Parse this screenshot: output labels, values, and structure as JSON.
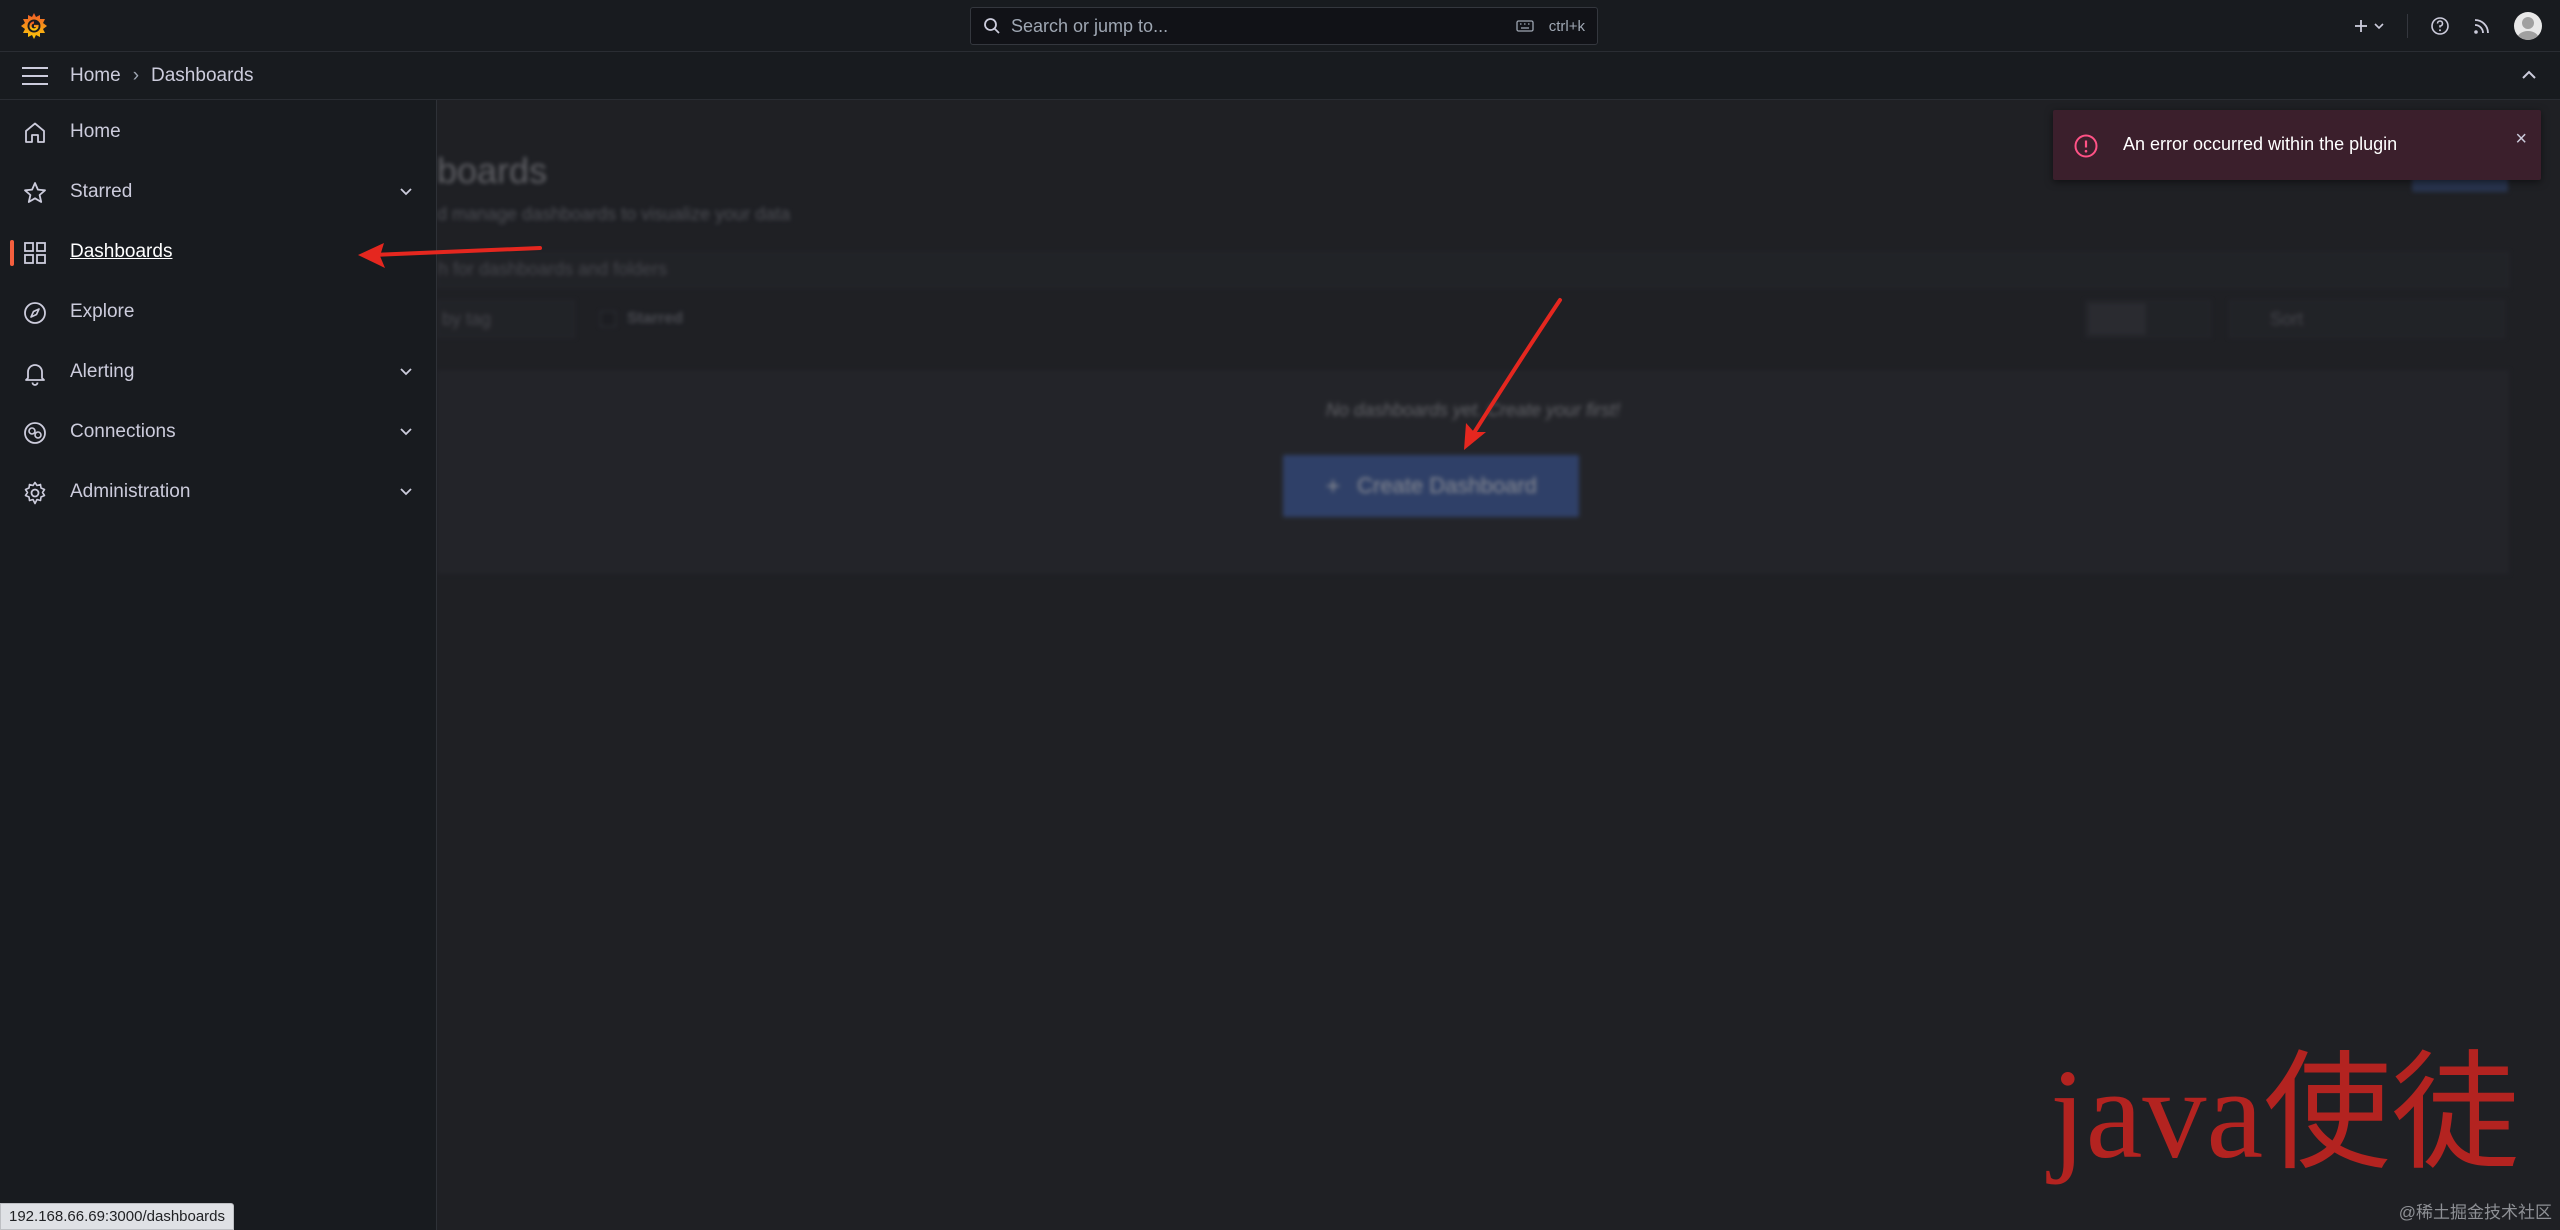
{
  "topbar": {
    "search_placeholder": "Search or jump to...",
    "search_shortcut": "ctrl+k"
  },
  "breadcrumb": {
    "home": "Home",
    "separator": "›",
    "current": "Dashboards"
  },
  "sidebar": {
    "items": [
      {
        "label": "Home",
        "icon": "home-icon",
        "expandable": false
      },
      {
        "label": "Starred",
        "icon": "star-icon",
        "expandable": true
      },
      {
        "label": "Dashboards",
        "icon": "apps-grid-icon",
        "expandable": false,
        "active": true
      },
      {
        "label": "Explore",
        "icon": "compass-icon",
        "expandable": false
      },
      {
        "label": "Alerting",
        "icon": "bell-icon",
        "expandable": true
      },
      {
        "label": "Connections",
        "icon": "link-icon",
        "expandable": true
      },
      {
        "label": "Administration",
        "icon": "gear-icon",
        "expandable": true
      }
    ]
  },
  "main": {
    "title": "boards",
    "subtitle": "d manage dashboards to visualize your data",
    "search_placeholder": "h for dashboards and folders",
    "tag_filter": "by tag",
    "starred_label": "Starred",
    "sort_label": "Sort",
    "empty_text": "No dashboards yet. Create your first!",
    "create_button": "Create Dashboard"
  },
  "toast": {
    "message": "An error occurred within the plugin",
    "close": "×"
  },
  "status_url": "192.168.66.69:3000/dashboards",
  "watermark": {
    "main": "java使徒",
    "small": "@稀土掘金技术社区"
  },
  "colors": {
    "accent": "#f55f3e",
    "primary_button": "#4865a5",
    "toast_bg": "#3b1f2c",
    "toast_icon": "#ff5286",
    "annotation_arrow": "#e5271f"
  }
}
